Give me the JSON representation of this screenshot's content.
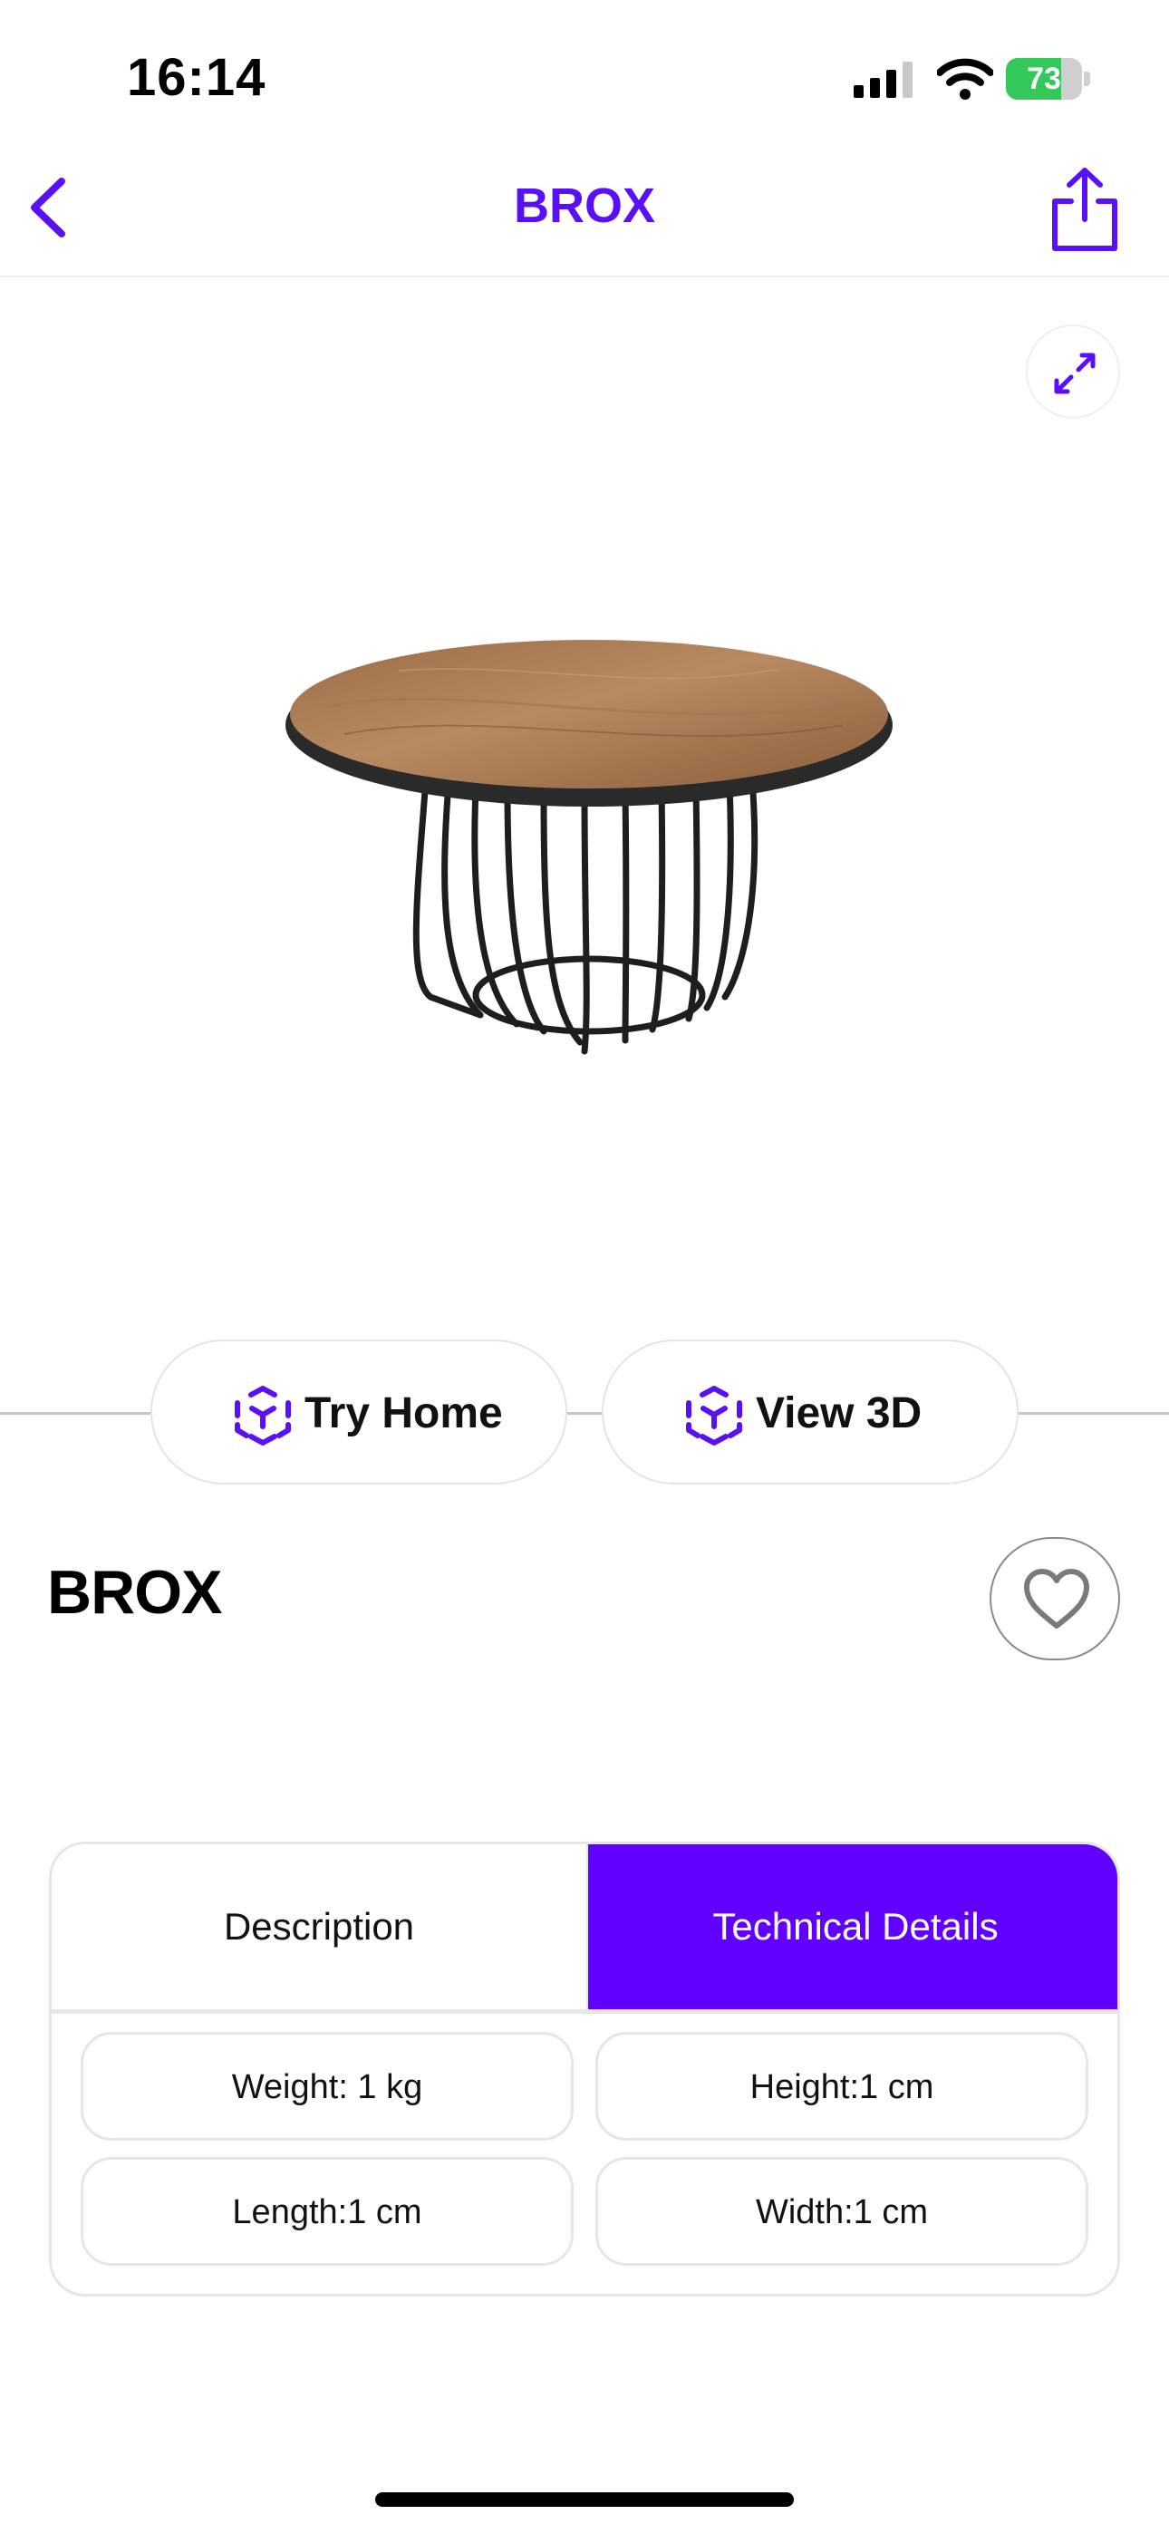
{
  "status_bar": {
    "time": "16:14",
    "battery_level": "73",
    "battery_fraction": 0.73,
    "icons": [
      "cellular-signal-icon",
      "wifi-icon",
      "battery-charging-icon"
    ]
  },
  "nav": {
    "title": "BROX",
    "back_icon": "chevron-left-icon",
    "share_icon": "share-icon"
  },
  "viewer": {
    "expand_icon": "expand-arrows-icon",
    "product_image": "round-wood-top-table-with-black-wire-cage-base"
  },
  "actions": {
    "try_home": "Try Home",
    "view_3d": "View 3D",
    "icon": "ar-cube-icon"
  },
  "product": {
    "name": "BROX",
    "favorite_icon": "heart-icon"
  },
  "details": {
    "tabs": [
      "Description",
      "Technical Details"
    ],
    "active_tab": "Technical Details",
    "specs": [
      "Weight: 1 kg",
      "Height:1 cm",
      "Length:1 cm",
      "Width:1 cm"
    ]
  },
  "colors": {
    "accent": "#6100ff",
    "accent_text": "#5a10f5",
    "battery_green": "#34c759",
    "border": "#e6e6e6"
  }
}
